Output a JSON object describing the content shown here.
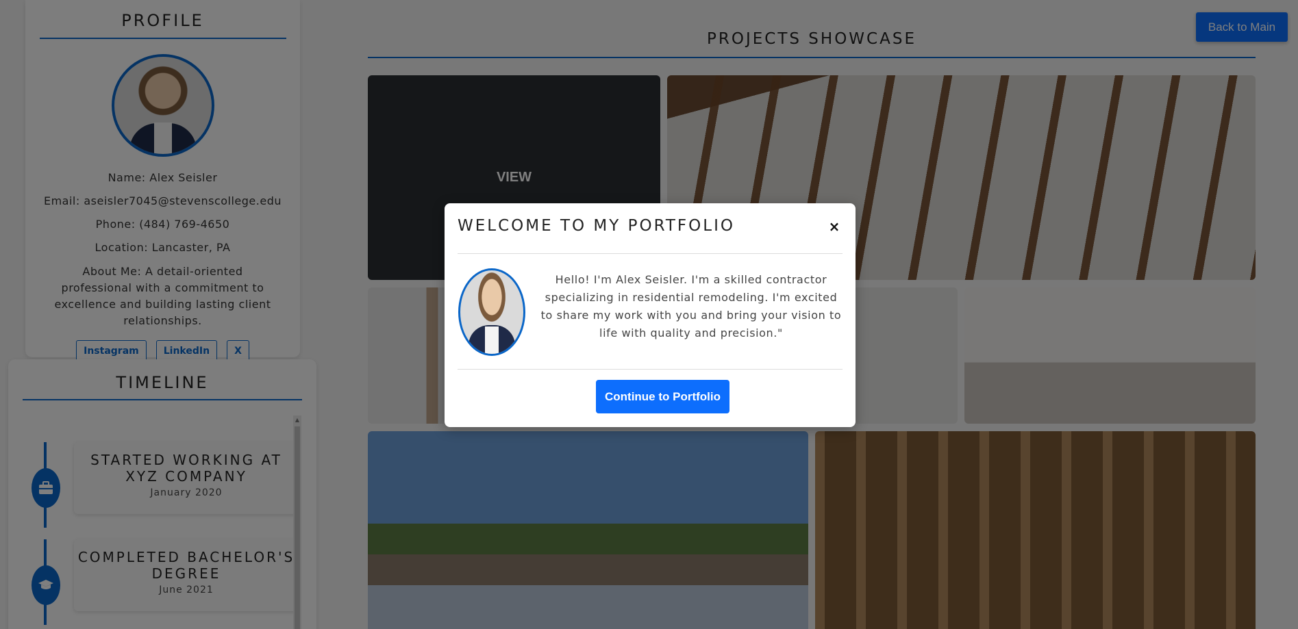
{
  "profile": {
    "title": "PROFILE",
    "name": "Name: Alex Seisler",
    "email": "Email: aseisler7045@stevenscollege.edu",
    "phone": "Phone: (484) 769-4650",
    "location": "Location: Lancaster, PA",
    "about": "About Me: A detail-oriented professional with a commitment to excellence and building lasting client relationships.",
    "social": [
      "Instagram",
      "LinkedIn",
      "X"
    ]
  },
  "timeline": {
    "title": "TIMELINE",
    "items": [
      {
        "title": "STARTED WORKING AT XYZ COMPANY",
        "date": "January 2020",
        "icon": "briefcase-icon"
      },
      {
        "title": "COMPLETED BACHELOR'S DEGREE",
        "date": "June 2021",
        "icon": "graduation-cap-icon"
      }
    ]
  },
  "projects": {
    "title": "PROJECTS SHOWCASE",
    "back_label": "Back to Main",
    "view_label": "VIEW"
  },
  "modal": {
    "title": "WELCOME TO MY PORTFOLIO",
    "close_label": "×",
    "message": "Hello! I'm Alex Seisler. I'm a skilled contractor specializing in residential remodeling. I'm excited to share my work with you and bring your vision to life with quality and precision.\"",
    "continue_label": "Continue to Portfolio"
  },
  "colors": {
    "accent": "#0a66c8",
    "button": "#0d6efd"
  }
}
